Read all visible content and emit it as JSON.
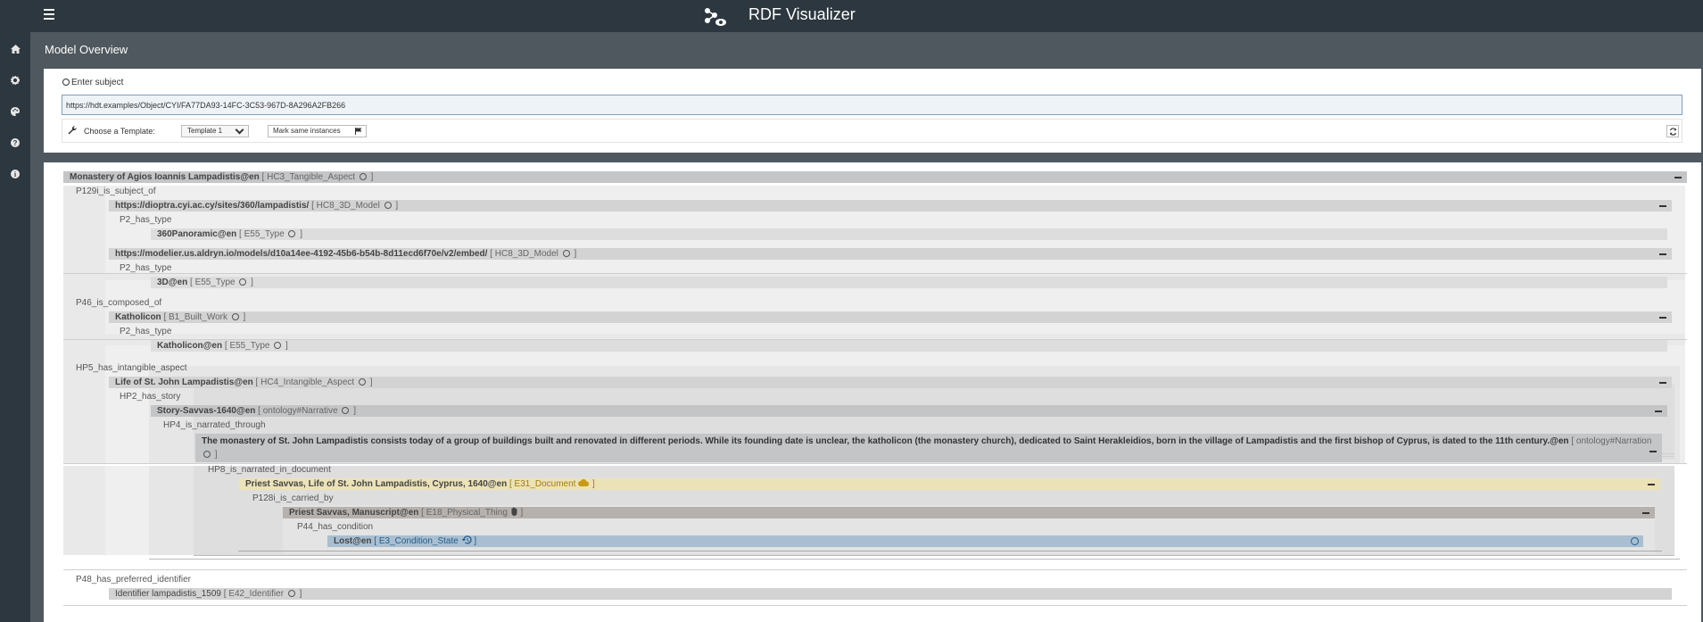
{
  "app": {
    "title": "RDF Visualizer"
  },
  "page": {
    "title": "Model Overview"
  },
  "subject": {
    "label": "Enter subject",
    "value": "https://hdt.examples/Object/CYI/FA77DA93-14FC-3C53-967D-8A296A2FB266"
  },
  "template": {
    "label": "Choose a Template:",
    "selected": "Template 1",
    "mark_button": "Mark same instances"
  },
  "icons": {
    "menu": "hamburger-icon",
    "logo": "graph-eye-icon",
    "sidebar": [
      "home-icon",
      "gear-icon",
      "palette-icon",
      "question-icon",
      "info-icon"
    ],
    "wrench": "wrench-icon",
    "flag": "flag-icon",
    "refresh": "refresh-icon"
  },
  "colors": {
    "topbar": "#2c373f",
    "node": "#d3d3d3",
    "document": "#ece2b8",
    "document_class": "#a37d0b",
    "physical": "#b6b1ad",
    "condition": "#a9bfd1",
    "condition_class": "#245d8b"
  },
  "tree": {
    "root": {
      "label": "Monastery of Agios Ioannis Lampadistis@en",
      "class": "HC3_Tangible_Aspect"
    },
    "p1": "P129i_is_subject_of",
    "n1": {
      "label": "https://dioptra.cyi.ac.cy/sites/360/lampadistis/",
      "class": "HC8_3D_Model"
    },
    "p1a": "P2_has_type",
    "n1a": {
      "label": "360Panoramic@en",
      "class": "E55_Type"
    },
    "n2": {
      "label": "https://modelier.us.aldryn.io/models/d10a14ee-4192-45b6-b54b-8d11ecd6f70e/v2/embed/",
      "class": "HC8_3D_Model"
    },
    "p2a": "P2_has_type",
    "n2a": {
      "label": "3D@en",
      "class": "E55_Type"
    },
    "p2": "P46_is_composed_of",
    "n3": {
      "label": "Katholicon",
      "class": "B1_Built_Work"
    },
    "p3a": "P2_has_type",
    "n3a": {
      "label": "Katholicon@en",
      "class": "E55_Type"
    },
    "p3": "HP5_has_intangible_aspect",
    "n4": {
      "label": "Life of St. John Lampadistis@en",
      "class": "HC4_Intangible_Aspect"
    },
    "p4a": "HP2_has_story",
    "n4a": {
      "label": "Story-Savvas-1640@en",
      "class": "ontology#Narrative"
    },
    "p4b": "HP4_is_narrated_through",
    "n4b": {
      "label": "The monastery of St. John Lampadistis consists today of a group of buildings built and renovated in different periods. While its founding date is unclear, the katholicon (the monastery church), dedicated to Saint Herakleidios, born in the village of Lampadistis and the first bishop of Cyprus, is dated to the 11th century.@en",
      "class": "ontology#Narration"
    },
    "p4c": "HP8_is_narrated_in_document",
    "n4c": {
      "label": "Priest Savvas, Life of St. John Lampadistis, Cyprus, 1640@en",
      "class": "E31_Document"
    },
    "p4d": "P128i_is_carried_by",
    "n4d": {
      "label": "Priest Savvas, Manuscript@en",
      "class": "E18_Physical_Thing"
    },
    "p4e": "P44_has_condition",
    "n4e": {
      "label": "Lost@en",
      "class": "E3_Condition_State"
    },
    "p5": "P48_has_preferred_identifier",
    "n5": {
      "label": "Identifier lampadistis_1509",
      "class": "E42_Identifier"
    }
  }
}
